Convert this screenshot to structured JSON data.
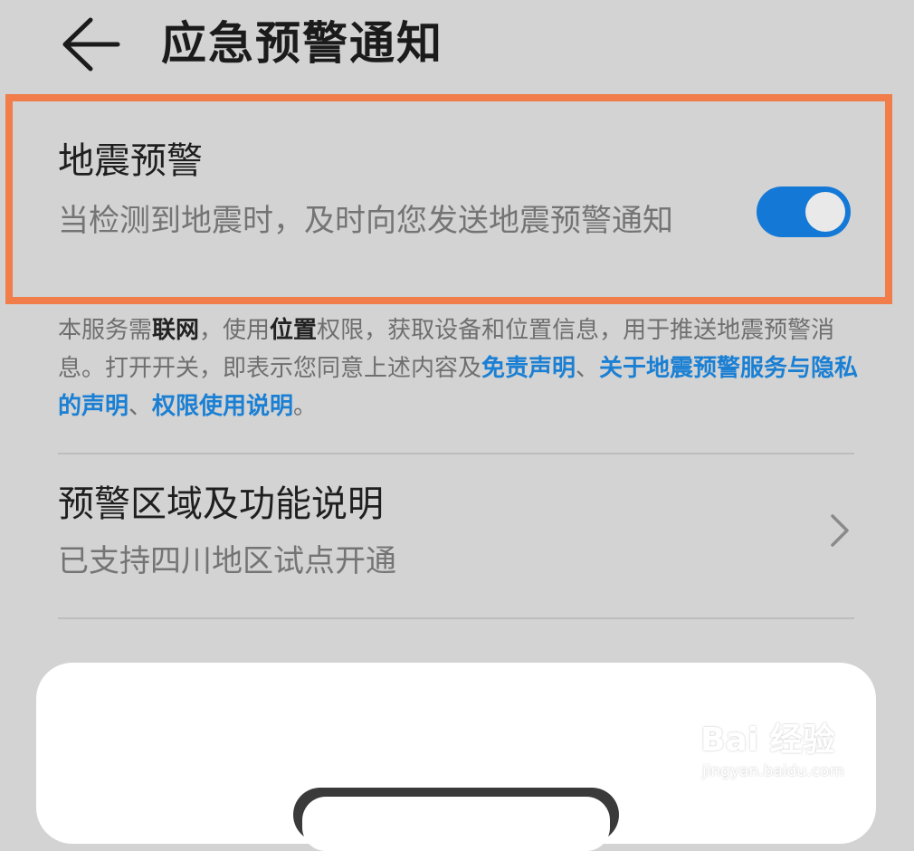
{
  "header": {
    "title": "应急预警通知",
    "back_icon": "arrow-left-icon"
  },
  "earthquake": {
    "title": "地震预警",
    "description": "当检测到地震时，及时向您发送地震预警通知",
    "toggle_on": true,
    "toggle_color": "#1479d6",
    "highlight_color": "#f07d4a"
  },
  "disclaimer": {
    "t1": "本服务需",
    "t2": "联网",
    "t3": "，使用",
    "t4": "位置",
    "t5": "权限，获取设备和位置信息，用于推送地震预警消息。打开开关，即表示您同意上述内容及",
    "link1": "免责声明",
    "sep1": "、",
    "link2": "关于地震预警服务与隐私的声明",
    "sep2": "、",
    "link3": "权限使用说明",
    "end": "。",
    "link_color": "#1b80d4"
  },
  "region": {
    "title": "预警区域及功能说明",
    "subtitle": "已支持四川地区试点开通",
    "chevron_icon": "chevron-right-icon"
  },
  "watermark": {
    "main": "Bai 经验",
    "sub": "jingyan.baidu.com"
  }
}
